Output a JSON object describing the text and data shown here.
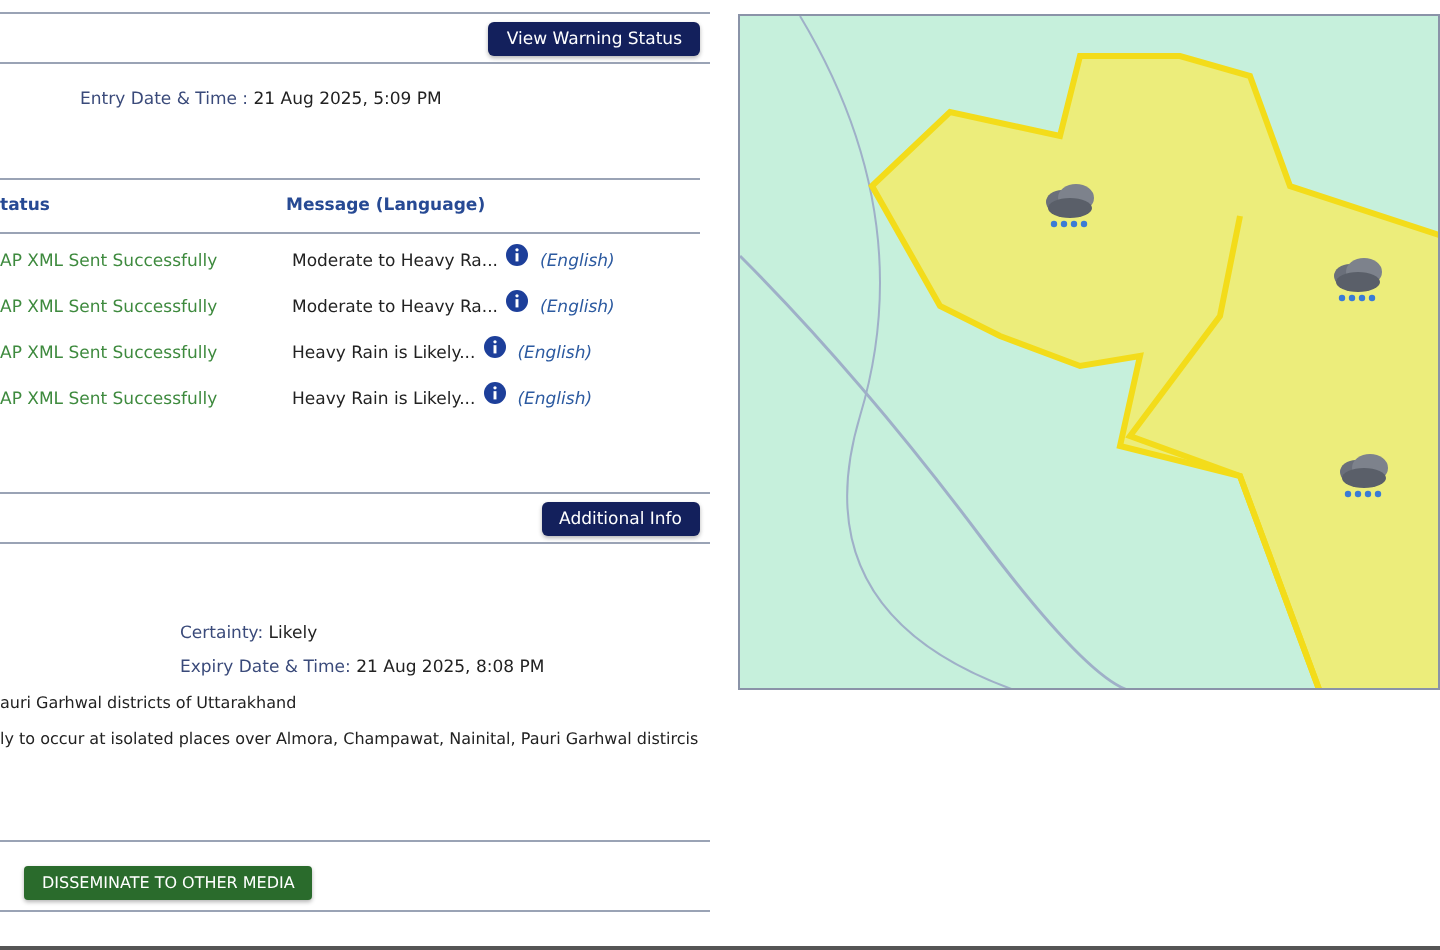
{
  "top_button": "View Warning Status",
  "entry": {
    "label": "Entry Date & Time :",
    "value": "21 Aug 2025, 5:09 PM"
  },
  "table": {
    "columns": [
      "tatus",
      "Message (Language)"
    ],
    "rows": [
      {
        "status": "AP XML Sent Successfully",
        "message": "Moderate to Heavy Ra...",
        "language": "(English)"
      },
      {
        "status": "AP XML Sent Successfully",
        "message": "Moderate to Heavy Ra...",
        "language": "(English)"
      },
      {
        "status": "AP XML Sent Successfully",
        "message": "Heavy Rain is Likely...",
        "language": "(English)"
      },
      {
        "status": "AP XML Sent Successfully",
        "message": "Heavy Rain is Likely...",
        "language": "(English)"
      }
    ]
  },
  "info_button": "Additional Info",
  "details": [
    {
      "label": "Certainty:",
      "value": "Likely"
    },
    {
      "label": "Expiry Date & Time:",
      "value": "21 Aug 2025, 8:08 PM"
    }
  ],
  "area": "auri Garhwal districts of Uttarakhand",
  "description": "ly to occur at isolated places over Almora, Champawat, Nainital, Pauri Garhwal distircis",
  "disseminate_button": "DISSEMINATE TO OTHER MEDIA"
}
